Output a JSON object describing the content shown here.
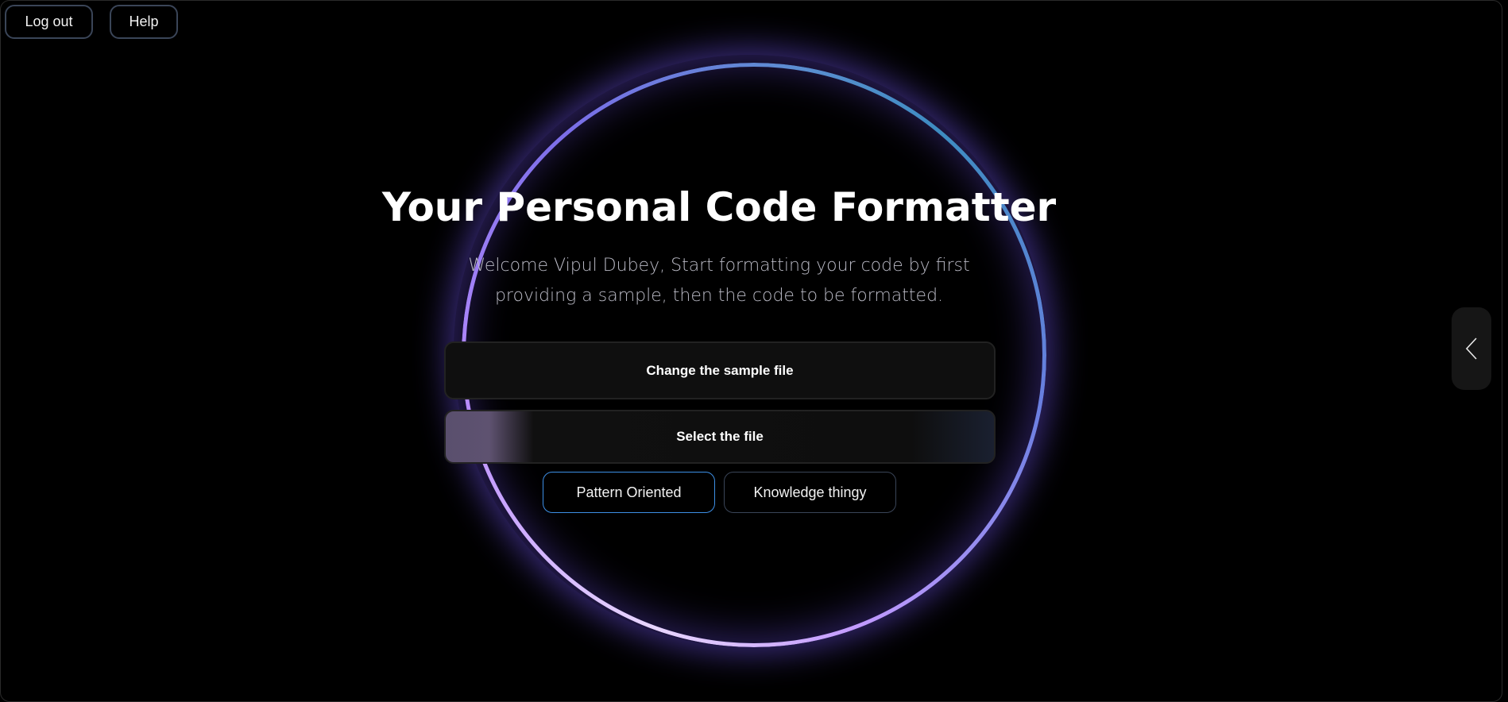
{
  "header": {
    "logout_label": "Log out",
    "help_label": "Help"
  },
  "main": {
    "title": "Your Personal Code Formatter",
    "subtitle": "Welcome Vipul Dubey, Start formatting your code by first providing a sample, then the code to be formatted.",
    "change_sample_label": "Change the sample file",
    "select_file_label": "Select the file",
    "modes": [
      {
        "label": "Pattern Oriented",
        "selected": true
      },
      {
        "label": "Knowledge thingy",
        "selected": false
      }
    ]
  },
  "side_panel": {
    "icon": "chevron-left-icon"
  },
  "colors": {
    "accent": "#3d8fe6",
    "ring_purple": "#b98cff",
    "ring_blue": "#3d8cc0"
  }
}
